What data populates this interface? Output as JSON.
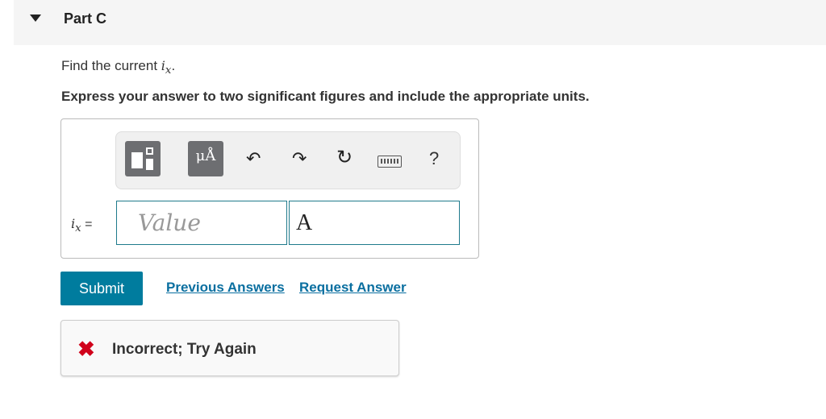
{
  "part": {
    "title": "Part C"
  },
  "question": {
    "prefix": "Find the current ",
    "variable": "i",
    "subscript": "x",
    "suffix": "."
  },
  "instruction": "Express your answer to two significant figures and include the appropriate units.",
  "toolbar": {
    "units_label": "μÅ",
    "undo_glyph": "↶",
    "redo_glyph": "↷",
    "reset_glyph": "↻",
    "help_label": "?"
  },
  "answer": {
    "variable": "i",
    "subscript": "x",
    "equals": " =",
    "value_placeholder": "Value",
    "value": "",
    "unit_value": "A"
  },
  "actions": {
    "submit_label": "Submit",
    "previous_answers_label": "Previous Answers",
    "request_answer_label": "Request Answer"
  },
  "feedback": {
    "icon_glyph": "✖",
    "message": "Incorrect; Try Again"
  },
  "colors": {
    "accent": "#007c9e",
    "link": "#0a6fa0",
    "error": "#d0021b",
    "input_border": "#1f7a8c"
  }
}
